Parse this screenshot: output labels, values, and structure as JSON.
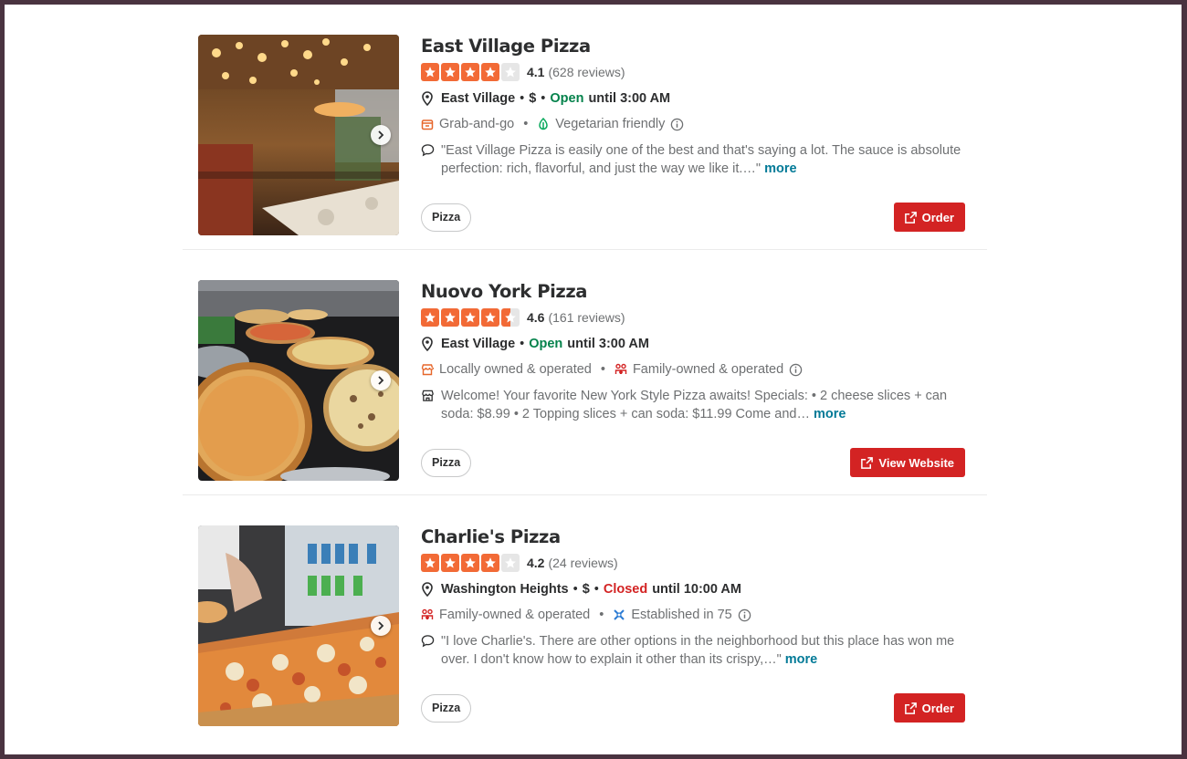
{
  "listings": [
    {
      "name": "East Village Pizza",
      "stars": [
        1,
        1,
        1,
        1,
        0
      ],
      "rating": "4.1",
      "reviews": "(628 reviews)",
      "location": "East Village",
      "price": "$",
      "status": "Open",
      "status_color": "#04824b",
      "hours": "until 3:00 AM",
      "attributes": [
        {
          "icon": "takeout-bag-icon",
          "label": "Grab-and-go"
        },
        {
          "icon": "leaf-icon",
          "label": "Vegetarian friendly"
        }
      ],
      "snippet_icon": "speech-bubble-icon",
      "snippet": "\"East Village Pizza is easily one of the best and that's saying a lot. The sauce is absolute perfection: rich, flavorful, and just the way we like it.…\"",
      "more": "more",
      "tag": "Pizza",
      "cta": "Order",
      "cta_icon": "external-link-icon"
    },
    {
      "name": "Nuovo York Pizza",
      "stars": [
        1,
        1,
        1,
        1,
        0.5
      ],
      "rating": "4.6",
      "reviews": "(161 reviews)",
      "location": "East Village",
      "price": "",
      "status": "Open",
      "status_color": "#04824b",
      "hours": "until 3:00 AM",
      "attributes": [
        {
          "icon": "storefront-icon",
          "label": "Locally owned & operated"
        },
        {
          "icon": "family-icon",
          "label": "Family-owned & operated"
        }
      ],
      "snippet_icon": "store-icon",
      "snippet": "Welcome! Your favorite New York Style Pizza awaits! Specials: • 2 cheese slices + can soda: $8.99 • 2 Topping slices + can soda: $11.99 Come and…",
      "more": "more",
      "tag": "Pizza",
      "cta": "View Website",
      "cta_icon": "external-link-icon"
    },
    {
      "name": "Charlie's Pizza",
      "stars": [
        1,
        1,
        1,
        1,
        0
      ],
      "rating": "4.2",
      "reviews": "(24 reviews)",
      "location": "Washington Heights",
      "price": "$",
      "status": "Closed",
      "status_color": "#d32323",
      "hours": "until 10:00 AM",
      "attributes": [
        {
          "icon": "family-icon",
          "label": "Family-owned & operated"
        },
        {
          "icon": "established-icon",
          "label": "Established in 75"
        }
      ],
      "snippet_icon": "speech-bubble-icon",
      "snippet": "\"I love Charlie's. There are other options in the neighborhood but this place has won me over. I don't know how to explain it other than its crispy,…\"",
      "more": "more",
      "tag": "Pizza",
      "cta": "Order",
      "cta_icon": "external-link-icon"
    }
  ],
  "colors": {
    "star_on": "#f26a36",
    "star_off": "#e6e6e6",
    "cta_bg": "#d32323",
    "link": "#027a97"
  }
}
